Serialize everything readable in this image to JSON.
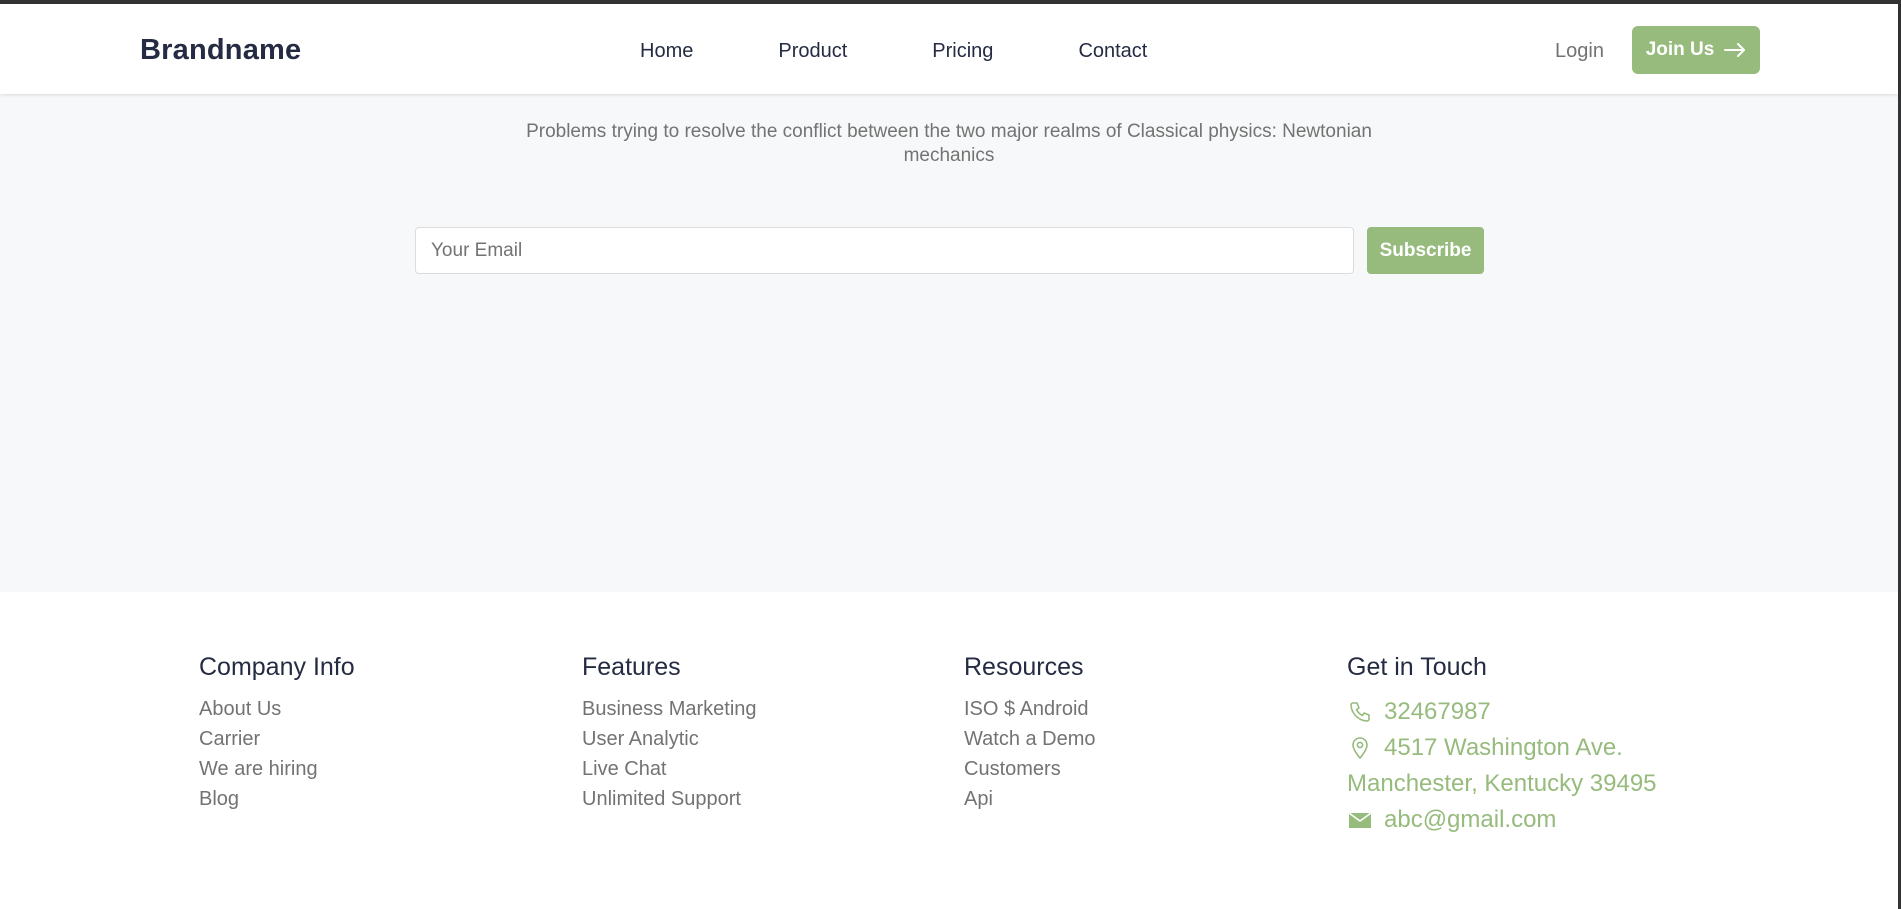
{
  "brand": "Brandname",
  "nav": {
    "items": [
      "Home",
      "Product",
      "Pricing",
      "Contact"
    ],
    "login": "Login",
    "join": "Join Us"
  },
  "hero": {
    "tagline": "Problems trying to resolve the conflict between the two major realms of Classical physics: Newtonian mechanics",
    "email_placeholder": "Your Email",
    "subscribe": "Subscribe"
  },
  "footer": {
    "company": {
      "title": "Company Info",
      "links": [
        "About Us",
        "Carrier",
        "We are hiring",
        "Blog"
      ]
    },
    "features": {
      "title": "Features",
      "links": [
        "Business Marketing",
        "User Analytic",
        "Live Chat",
        "Unlimited Support"
      ]
    },
    "resources": {
      "title": "Resources",
      "links": [
        "ISO $ Android",
        "Watch a Demo",
        "Customers",
        "Api"
      ]
    },
    "contact": {
      "title": "Get in Touch",
      "phone": "32467987",
      "address_line1": "4517 Washington Ave.",
      "address_line2": "Manchester, Kentucky 39495",
      "email": "abc@gmail.com"
    }
  },
  "colors": {
    "accent": "#96bb7c",
    "heading": "#252b42",
    "muted": "#737373",
    "hero_bg": "#f7f8f9"
  },
  "icons": [
    "arrow-right-icon",
    "phone-icon",
    "location-pin-icon",
    "mail-icon"
  ]
}
